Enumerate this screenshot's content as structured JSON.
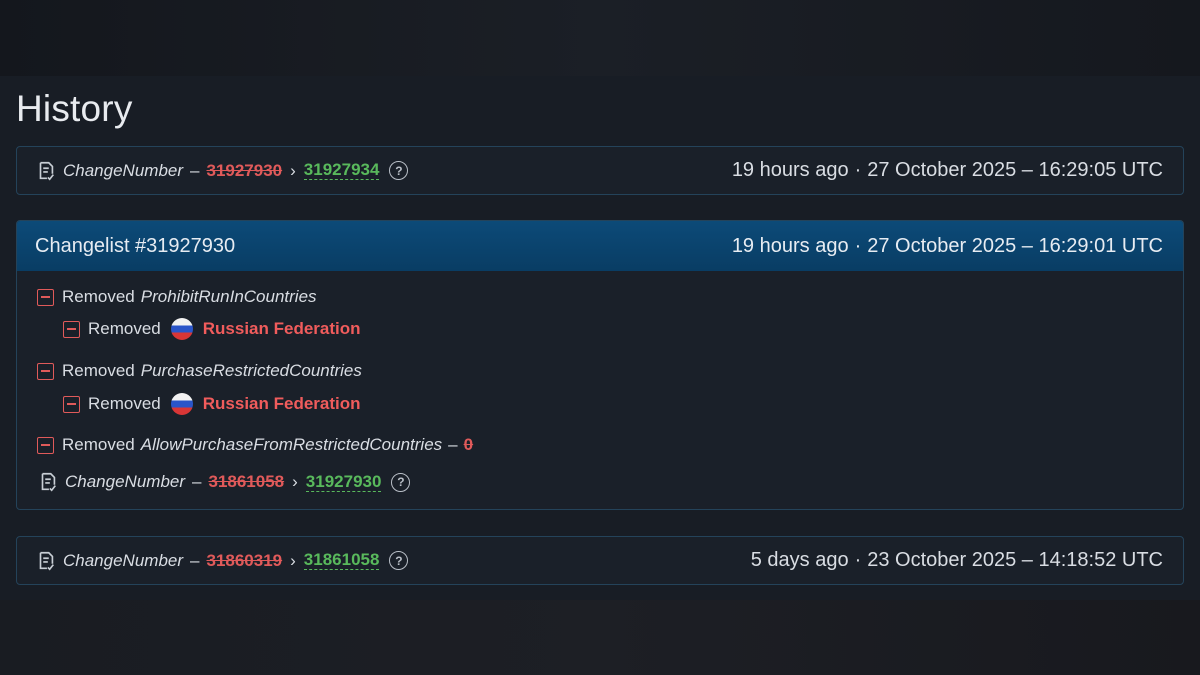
{
  "page": {
    "title": "History"
  },
  "entries": [
    {
      "type": "change",
      "key": "ChangeNumber",
      "old_value": "31927930",
      "new_value": "31927934",
      "relative_time": "19 hours ago",
      "separator": "·",
      "absolute_time": "27 October 2025 – 16:29:05 UTC"
    },
    {
      "type": "changelist",
      "title": "Changelist #31927930",
      "relative_time": "19 hours ago",
      "separator": "·",
      "absolute_time": "27 October 2025 – 16:29:01 UTC",
      "items": [
        {
          "action": "Removed",
          "key": "ProhibitRunInCountries"
        },
        {
          "action": "Removed",
          "value": "Russian Federation",
          "flag": "russia-flag"
        },
        {
          "action": "Removed",
          "key": "PurchaseRestrictedCountries"
        },
        {
          "action": "Removed",
          "value": "Russian Federation",
          "flag": "russia-flag"
        },
        {
          "action": "Removed",
          "key": "AllowPurchaseFromRestrictedCountries",
          "dash": "–",
          "old_value": "0"
        },
        {
          "key": "ChangeNumber",
          "dash": "–",
          "old_value": "31861058",
          "new_value": "31927930"
        }
      ]
    },
    {
      "type": "change",
      "key": "ChangeNumber",
      "old_value": "31860319",
      "new_value": "31861058",
      "relative_time": "5 days ago",
      "separator": "·",
      "absolute_time": "23 October 2025 – 14:18:52 UTC"
    }
  ],
  "symbols": {
    "dash": "–",
    "arrow": "›",
    "help": "?"
  },
  "colors": {
    "removed": "#e05a5a",
    "added": "#59b95c",
    "changelist_header": "#0c4a78",
    "card_border": "#24435a",
    "background": "#181d25"
  },
  "icons": [
    "document-check-icon",
    "help-circle-icon",
    "minus-square-icon",
    "russia-flag"
  ]
}
